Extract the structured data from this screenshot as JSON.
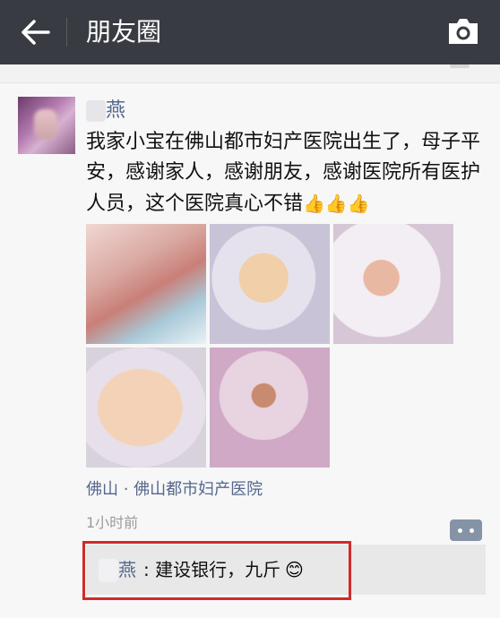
{
  "header": {
    "title": "朋友圈",
    "back_icon": "back-arrow-icon",
    "camera_icon": "camera-icon",
    "background_color": "#383c42"
  },
  "post": {
    "author": "燕",
    "content": "我家小宝在佛山都市妇产医院出生了，母子平安，感谢家人，感谢朋友，感谢医院所有医护人员，这个医院真心不错",
    "emoji": "👍👍👍",
    "photos": [
      "baby-hand-photo",
      "baby-awake-photo",
      "baby-sleeping-photo",
      "baby-closeup-photo",
      "baby-wrapped-photo"
    ],
    "location": "佛山 · 佛山都市妇产医院",
    "time": "1小时前",
    "comment": {
      "author": "燕",
      "text": ": 建设银行，九斤",
      "emoji": "😊"
    },
    "name_color": "#55678c",
    "highlight_color": "#d02a2a"
  }
}
